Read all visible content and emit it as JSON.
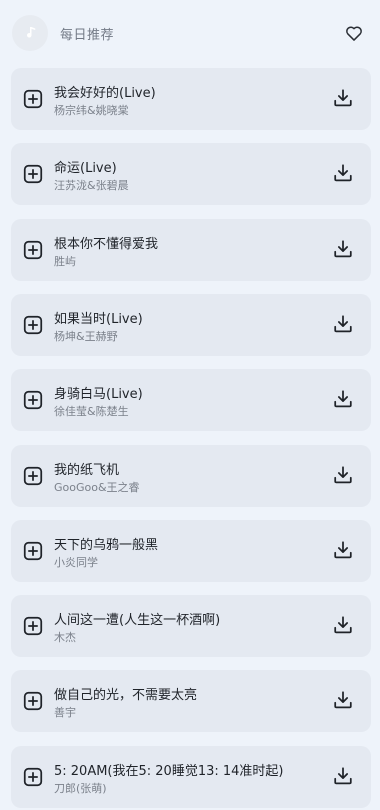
{
  "header": {
    "title": "每日推荐",
    "avatar_icon": "music-note-icon",
    "favorite_icon": "heart-outline-icon"
  },
  "songs": [
    {
      "title": "我会好好的(Live)",
      "artist": "杨宗纬&姚晓棠"
    },
    {
      "title": "命运(Live)",
      "artist": "汪苏泷&张碧晨"
    },
    {
      "title": "根本你不懂得爱我",
      "artist": "胜屿"
    },
    {
      "title": "如果当时(Live)",
      "artist": "杨坤&王赫野"
    },
    {
      "title": "身骑白马(Live)",
      "artist": "徐佳莹&陈楚生"
    },
    {
      "title": "我的纸飞机",
      "artist": "GooGoo&王之睿"
    },
    {
      "title": "天下的乌鸦一般黑",
      "artist": "小炎同学"
    },
    {
      "title": "人间这一遭(人生这一杯酒啊)",
      "artist": "木杰"
    },
    {
      "title": "做自己的光，不需要太亮",
      "artist": "善宇"
    },
    {
      "title": "5: 20AM(我在5: 20睡觉13: 14准时起)",
      "artist": "刀郎(张萌)"
    }
  ],
  "icons": {
    "add": "add-to-playlist-icon",
    "download": "download-icon"
  },
  "colors": {
    "background": "#eef3fa",
    "card": "#e4e9f1",
    "title_text": "#1f2329",
    "secondary_text": "#7b818b"
  }
}
